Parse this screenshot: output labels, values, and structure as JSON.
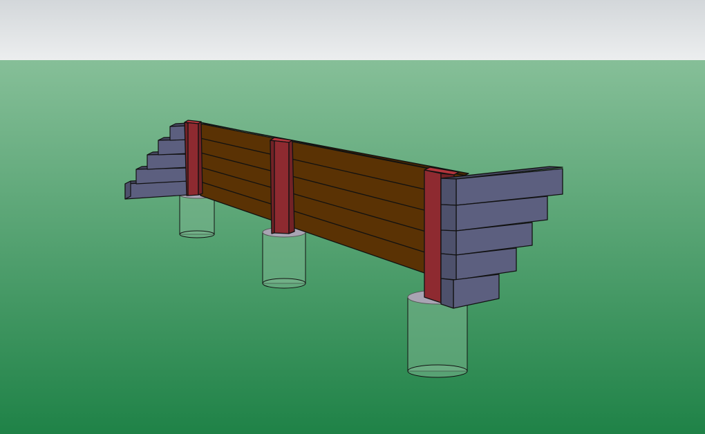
{
  "scene": {
    "model": "retaining-wall",
    "sky_color_top": "#d3d7da",
    "sky_color_bottom": "#eceeef",
    "ground_color_top": "#86bf98",
    "ground_color_bottom": "#1f8247",
    "post_color": "#8e2a30",
    "plank_color": "#5a3204",
    "wingwall_color": "#5c5f7f",
    "footing_color": "#7ab58e",
    "edge_color": "#111111"
  }
}
